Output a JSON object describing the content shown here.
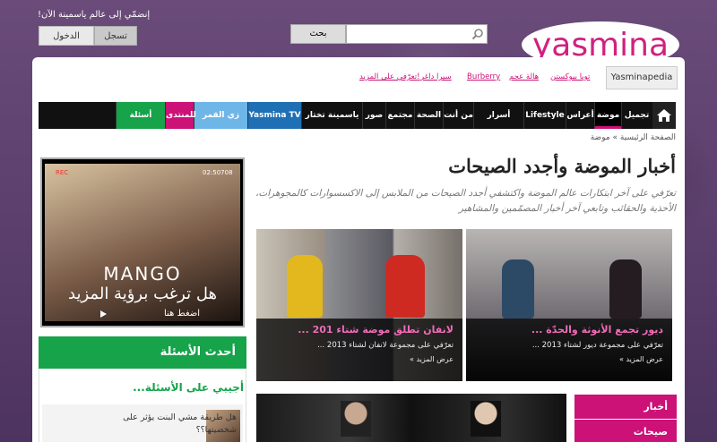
{
  "header": {
    "join_text": "إنضمّي إلى عالم ياسمينة الآن!",
    "login_label": "الدخول",
    "register_label": "تسجل",
    "search_button": "بحث",
    "search_placeholder": "",
    "logo_text": "yasmina"
  },
  "trends": {
    "wiki_label": "Yasminapedia",
    "links": [
      "تويا بيوكستن",
      "هالة عجم",
      "Burberry",
      "سيرا داغر",
      "تعرّفي على المزيد!"
    ]
  },
  "nav": {
    "items": [
      "تجميل",
      "موضة",
      "أعراس",
      "Lifestyle",
      "أسرار النجاح",
      "من أنت",
      "الصحة",
      "مجتمع",
      "صور",
      "ياسمينة تختار لك",
      "Yasmina TV",
      "زي القمر",
      "للمنتدى",
      "أسئلة وأجوبة"
    ]
  },
  "breadcrumb": "الصفحة الرئيسية » موضة",
  "page": {
    "title": "أخبار الموضة وأجدد الصيحات",
    "intro": "تعرّفي على آخر ابتكارات عالم الموضة واكتشفي أجدد الصيحات من الملابس إلى الاكسسوارات كالمجوهرات، الأحذية والحقائب وتابعي آخر أخبار المصمّمين والمشاهير"
  },
  "video": {
    "rec": "REC",
    "time": "02:50708",
    "brand": "MANGO",
    "headline": "هل ترغب برؤية المزيد",
    "button": "اضغط هنا"
  },
  "questions": {
    "header": "أحدث الأسئلة",
    "sub": "أجيبي على الأسئلة...",
    "q1": "هل طريقة مشي البنت يؤثر على شخصيتها؟؟"
  },
  "features": [
    {
      "title": "ديور تجمع الأنوثة والحدّة ...",
      "subtitle": "تعرّفي على مجموعة ديور لشتاء 2013 ...",
      "more": "عرض المزيد »"
    },
    {
      "title": "لانفان تطلق موضة شتاء 201 ...",
      "subtitle": "تعرّفي على مجموعة لانفان لشتاء 2013 ...",
      "more": "عرض المزيد »"
    }
  ],
  "sidebar": {
    "items": [
      "أخبار",
      "صيحات"
    ]
  },
  "colors": {
    "brand": "#cc1177",
    "nav": "#111111",
    "questions": "#16a34a",
    "tv": "#1f6fb4"
  }
}
